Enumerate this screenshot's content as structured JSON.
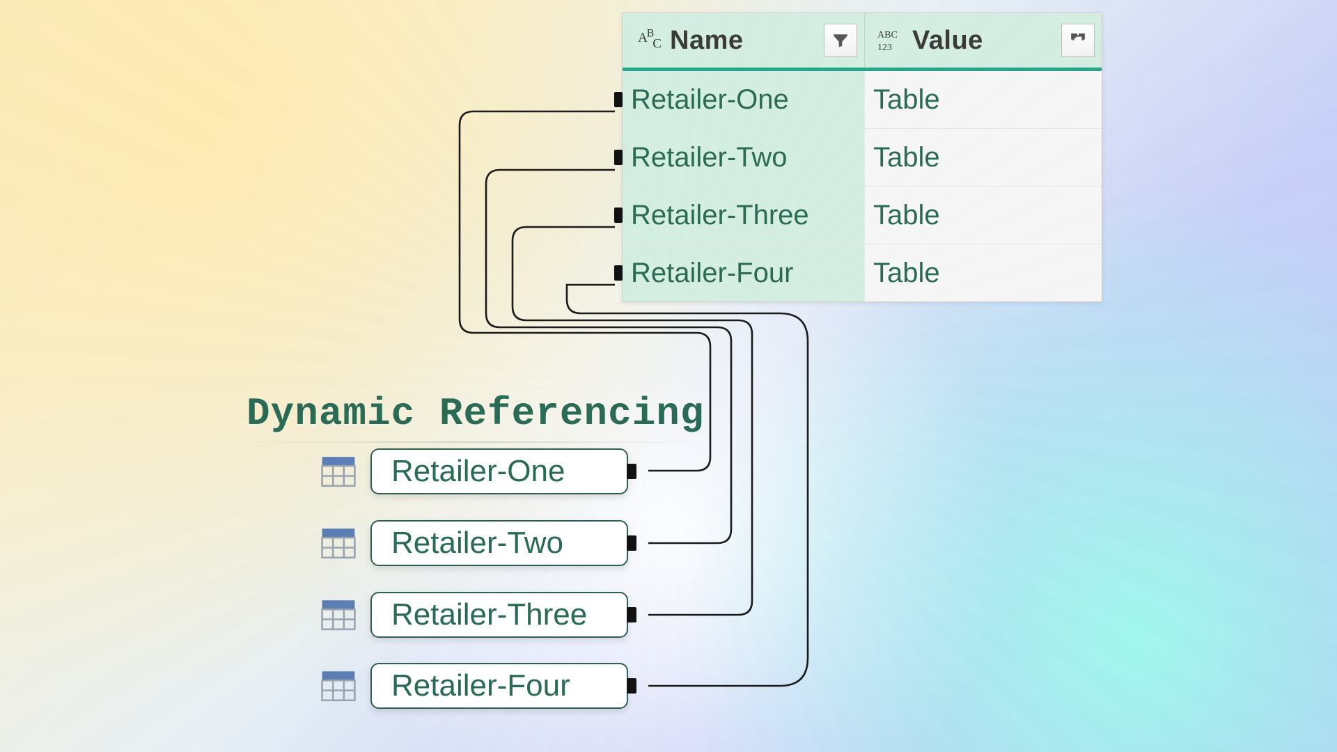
{
  "heading": "Dynamic Referencing",
  "table": {
    "columns": {
      "name": {
        "label": "Name",
        "type_icon": "text-type-icon"
      },
      "value": {
        "label": "Value",
        "type_icon": "any-type-icon"
      }
    },
    "rows": [
      {
        "name": "Retailer-One",
        "value": "Table"
      },
      {
        "name": "Retailer-Two",
        "value": "Table"
      },
      {
        "name": "Retailer-Three",
        "value": "Table"
      },
      {
        "name": "Retailer-Four",
        "value": "Table"
      }
    ]
  },
  "queries": [
    {
      "label": "Retailer-One"
    },
    {
      "label": "Retailer-Two"
    },
    {
      "label": "Retailer-Three"
    },
    {
      "label": "Retailer-Four"
    }
  ],
  "colors": {
    "accent_green": "#25a68a",
    "text_green": "#2a6b55",
    "header_bg": "#d5eee2"
  }
}
